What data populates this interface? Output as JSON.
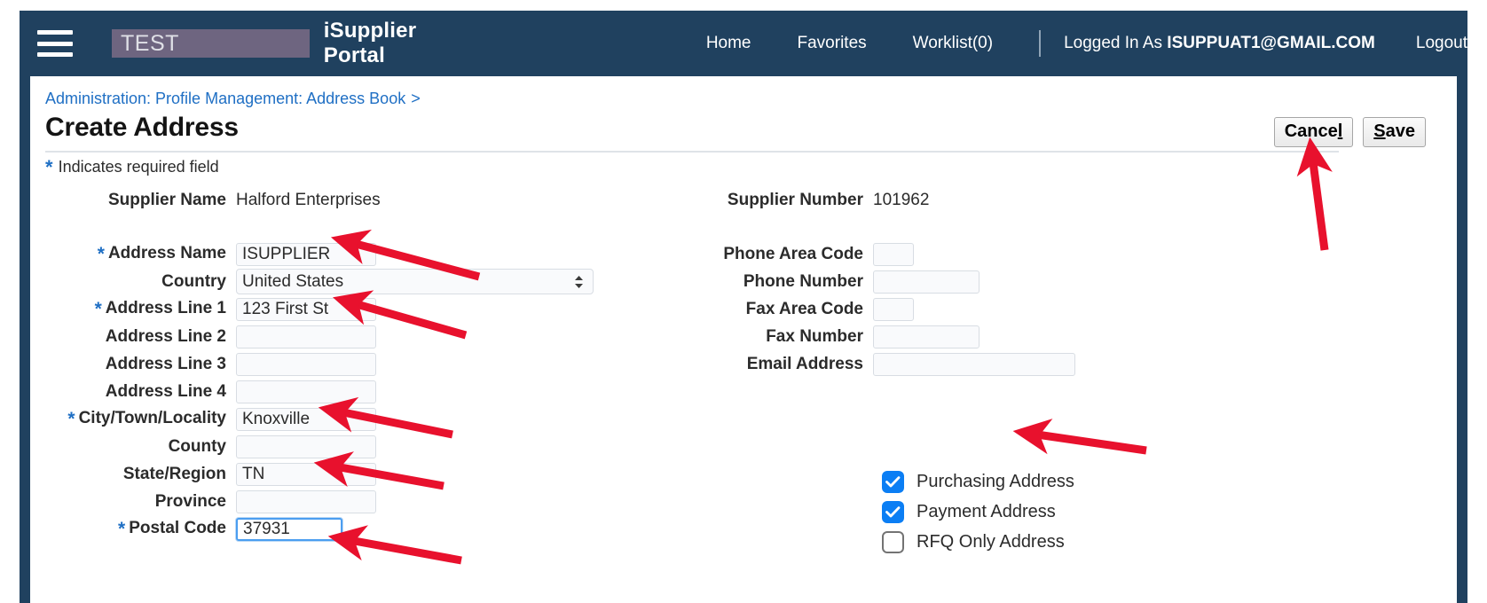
{
  "topnav": {
    "hamburger_icon": "menu-icon",
    "env_badge": "TEST",
    "portal_title": "iSupplier Portal",
    "links": [
      {
        "label": "Home"
      },
      {
        "label": "Favorites"
      },
      {
        "label": "Worklist(0)"
      }
    ],
    "logged_in_prefix": "Logged In As",
    "logged_in_user": "ISUPPUAT1@GMAIL.COM",
    "logout_label": "Logout"
  },
  "page": {
    "breadcrumb": "Administration: Profile Management: Address Book",
    "breadcrumb_caret": ">",
    "title": "Create Address",
    "required_note": "Indicates required field",
    "required_star": "*"
  },
  "actions": {
    "cancel_label_pre": "Cance",
    "cancel_label_key": "l",
    "save_label_key": "S",
    "save_label_post": "ave"
  },
  "left_form": {
    "supplier_name_label": "Supplier Name",
    "supplier_name_value": "Halford Enterprises",
    "address_name_label": "Address Name",
    "address_name_value": "ISUPPLIER",
    "country_label": "Country",
    "country_value": "United States",
    "address_line1_label": "Address Line 1",
    "address_line1_value": "123 First St",
    "address_line2_label": "Address Line 2",
    "address_line2_value": "",
    "address_line3_label": "Address Line 3",
    "address_line3_value": "",
    "address_line4_label": "Address Line 4",
    "address_line4_value": "",
    "city_label": "City/Town/Locality",
    "city_value": "Knoxville",
    "county_label": "County",
    "county_value": "",
    "state_label": "State/Region",
    "state_value": "TN",
    "province_label": "Province",
    "province_value": "",
    "postal_code_label": "Postal Code",
    "postal_code_value": "37931"
  },
  "right_form": {
    "supplier_number_label": "Supplier Number",
    "supplier_number_value": "101962",
    "phone_area_code_label": "Phone Area Code",
    "phone_area_code_value": "",
    "phone_number_label": "Phone Number",
    "phone_number_value": "",
    "fax_area_code_label": "Fax Area Code",
    "fax_area_code_value": "",
    "fax_number_label": "Fax Number",
    "fax_number_value": "",
    "email_address_label": "Email Address",
    "email_address_value": ""
  },
  "checkboxes": [
    {
      "label": "Purchasing Address",
      "checked": true
    },
    {
      "label": "Payment Address",
      "checked": true
    },
    {
      "label": "RFQ Only Address",
      "checked": false
    }
  ],
  "colors": {
    "navy_header": "#20415f",
    "link_blue": "#1f6fc4",
    "checkbox_blue": "#0b7ef4",
    "annotation_red": "#e8112d",
    "env_badge_bg": "#6e6580",
    "focus_blue": "#4b9ef0"
  }
}
